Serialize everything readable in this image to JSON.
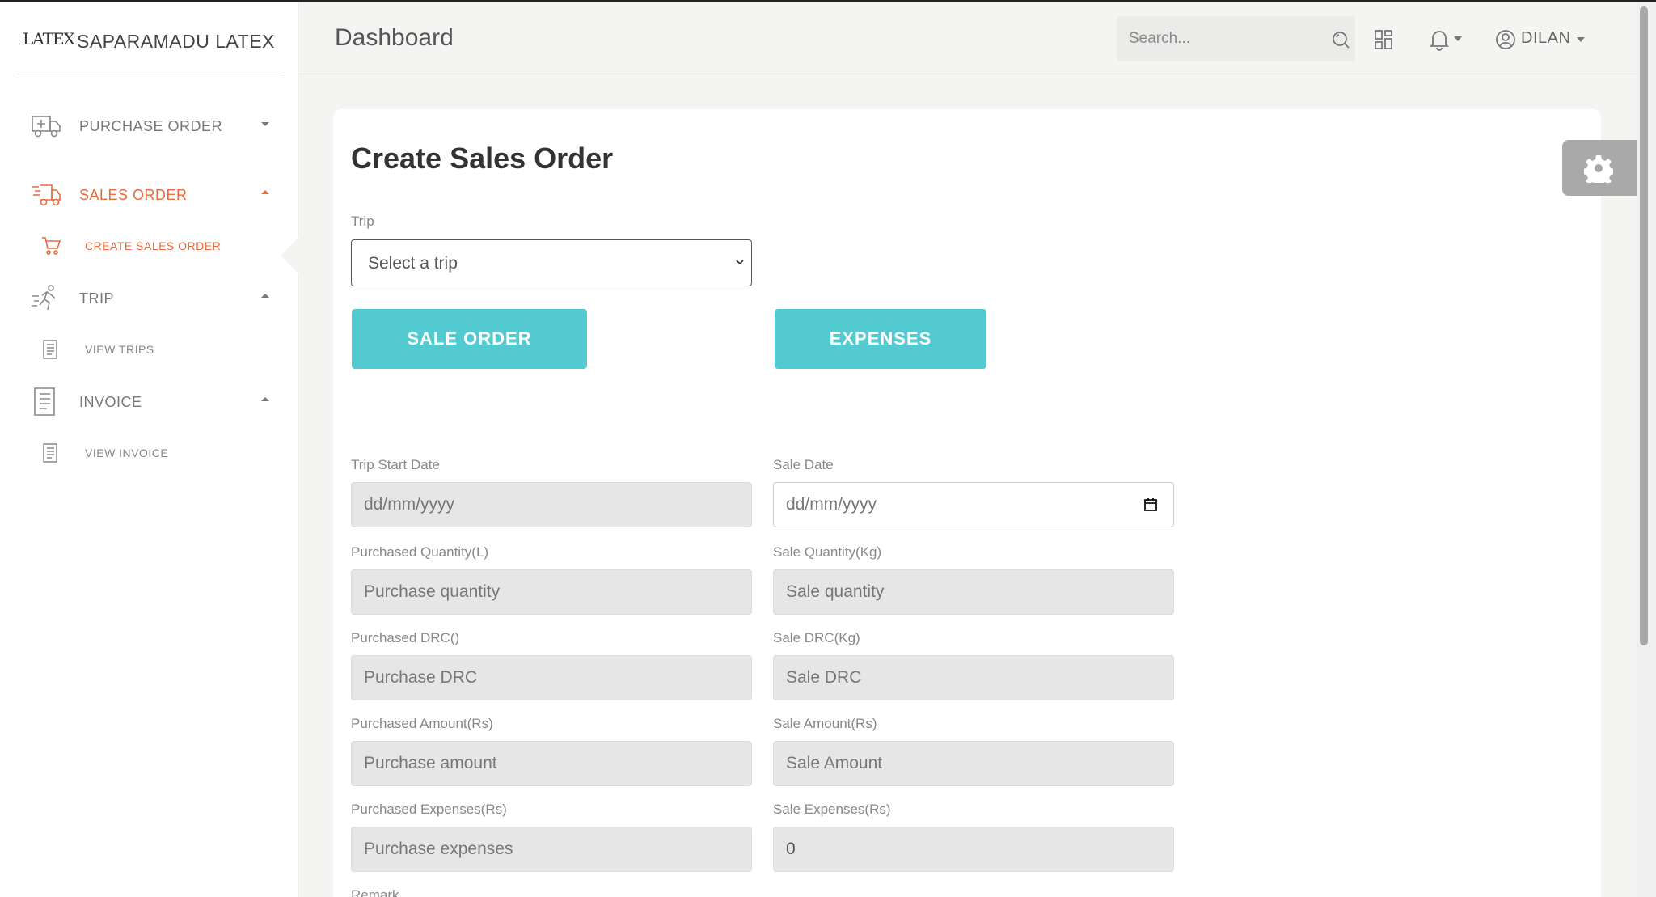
{
  "brand": {
    "logo": "LATEX",
    "title": "SAPARAMADU LATEX"
  },
  "sidebar": {
    "items": [
      {
        "label": "PURCHASE ORDER",
        "icon": "truck-plus-icon",
        "active": false
      },
      {
        "label": "SALES ORDER",
        "icon": "fast-delivery-icon",
        "active": true
      },
      {
        "label": "TRIP",
        "icon": "runner-icon",
        "active": false
      },
      {
        "label": "INVOICE",
        "icon": "document-icon",
        "active": false
      }
    ],
    "subitems": [
      {
        "label": "CREATE SALES ORDER",
        "icon": "cart-icon",
        "active": true
      },
      {
        "label": "VIEW TRIPS",
        "icon": "document-icon",
        "active": false
      },
      {
        "label": "VIEW INVOICE",
        "icon": "document-icon",
        "active": false
      }
    ]
  },
  "header": {
    "title": "Dashboard",
    "search_placeholder": "Search...",
    "user": "DILAN"
  },
  "form": {
    "title": "Create Sales Order",
    "trip_label": "Trip",
    "trip_selected": "Select a trip",
    "buttons": {
      "sale_order": "SALE ORDER",
      "expenses": "EXPENSES"
    },
    "fields": {
      "trip_start_date": {
        "label": "Trip Start Date",
        "placeholder": "dd/mm/yyyy"
      },
      "sale_date": {
        "label": "Sale Date",
        "placeholder": "dd/mm/yyyy"
      },
      "purchased_quantity": {
        "label": "Purchased Quantity(L)",
        "placeholder": "Purchase quantity"
      },
      "sale_quantity": {
        "label": "Sale Quantity(Kg)",
        "placeholder": "Sale quantity"
      },
      "purchased_drc": {
        "label": "Purchased DRC()",
        "placeholder": "Purchase DRC"
      },
      "sale_drc": {
        "label": "Sale DRC(Kg)",
        "placeholder": "Sale DRC"
      },
      "purchased_amount": {
        "label": "Purchased Amount(Rs)",
        "placeholder": "Purchase amount"
      },
      "sale_amount": {
        "label": "Sale Amount(Rs)",
        "placeholder": "Sale Amount"
      },
      "purchased_expenses": {
        "label": "Purchased Expenses(Rs)",
        "placeholder": "Purchase expenses"
      },
      "sale_expenses": {
        "label": "Sale Expenses(Rs)",
        "value": "0"
      },
      "remark": {
        "label": "Remark"
      }
    }
  },
  "colors": {
    "accent": "#ea6a3c",
    "button": "#53c9d0",
    "background": "#f4f4f2"
  }
}
